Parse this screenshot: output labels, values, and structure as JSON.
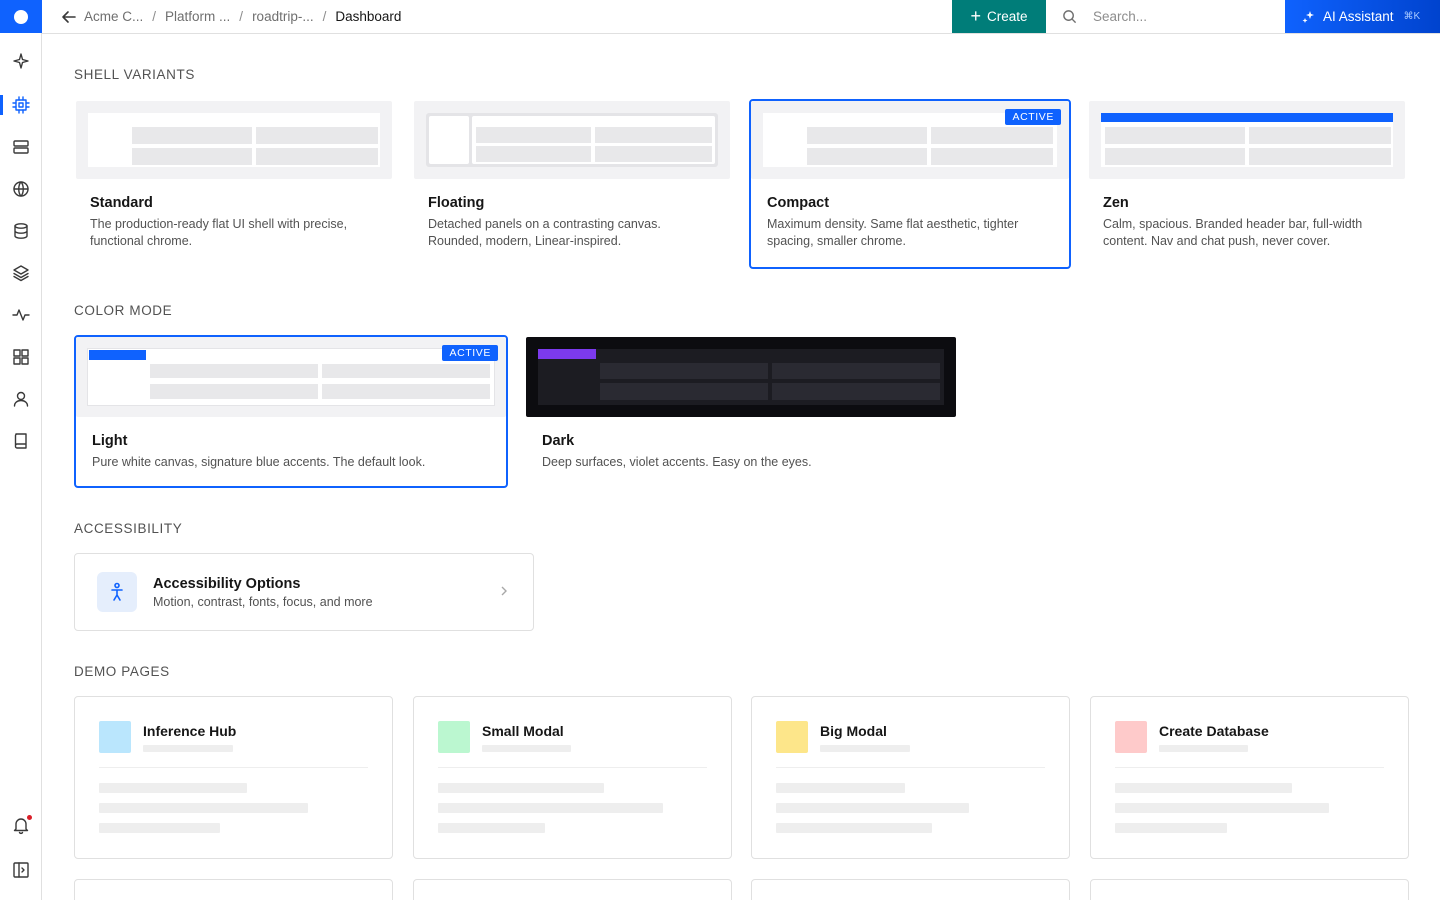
{
  "topbar": {
    "breadcrumb": [
      "Acme C...",
      "Platform ...",
      "roadtrip-..."
    ],
    "breadcrumb_current": "Dashboard",
    "create_label": "Create",
    "search_placeholder": "Search...",
    "ai_label": "AI Assistant",
    "ai_shortcut": "⌘K"
  },
  "rail": {
    "items": [
      "sparkle-icon",
      "chip-icon",
      "server-icon",
      "globe-icon",
      "database-icon",
      "layers-icon",
      "activity-icon",
      "grid-icon",
      "user-icon",
      "book-icon",
      "bell-icon",
      "sidebar-toggle-icon"
    ],
    "active": "chip-icon"
  },
  "sections": {
    "shell": "SHELL VARIANTS",
    "color": "COLOR MODE",
    "a11y": "ACCESSIBILITY",
    "demo": "DEMO PAGES"
  },
  "shell_variants": [
    {
      "name": "Standard",
      "desc": "The production-ready flat UI shell with precise, functional chrome.",
      "active": false
    },
    {
      "name": "Floating",
      "desc": "Detached panels on a contrasting canvas. Rounded, modern, Linear-inspired.",
      "active": false
    },
    {
      "name": "Compact",
      "desc": "Maximum density. Same flat aesthetic, tighter spacing, smaller chrome.",
      "active": true
    },
    {
      "name": "Zen",
      "desc": "Calm, spacious. Branded header bar, full-width content. Nav and chat push, never cover.",
      "active": false
    }
  ],
  "color_modes": [
    {
      "name": "Light",
      "desc": "Pure white canvas, signature blue accents. The default look.",
      "active": true
    },
    {
      "name": "Dark",
      "desc": "Deep surfaces, violet accents. Easy on the eyes.",
      "active": false
    }
  ],
  "active_badge": "ACTIVE",
  "accessibility": {
    "title": "Accessibility Options",
    "desc": "Motion, contrast, fonts, focus, and more"
  },
  "demo_pages": [
    {
      "title": "Inference Hub",
      "color": "#bae6fd"
    },
    {
      "title": "Small Modal",
      "color": "#bbf7d0"
    },
    {
      "title": "Big Modal",
      "color": "#fde68a"
    },
    {
      "title": "Create Database",
      "color": "#fecaca"
    }
  ],
  "colors": {
    "accent": "#0f62fe",
    "create": "#007d79",
    "dark_accent": "#7c3aed"
  }
}
